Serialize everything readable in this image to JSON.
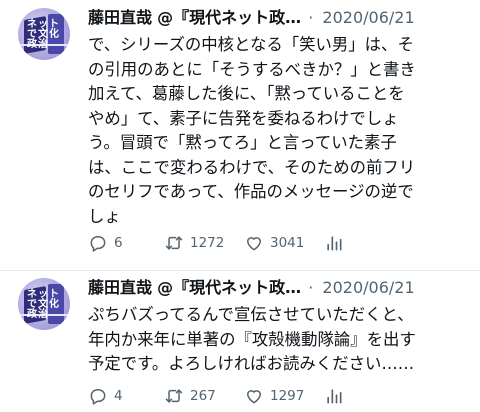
{
  "tweets": [
    {
      "author": "藤田直哉",
      "handle": "@『現代ネット政…",
      "separator": "·",
      "date": "2020/06/21",
      "lines": [
        "で、シリーズの中核となる「笑い男」は、そ",
        "の引用のあとに「そうするべきか？」と書き",
        "加えて、葛藤した後に、「黙っていることを",
        "やめ」て、素子に告発を委ねるわけでしょ",
        "う。冒頭で「黙ってろ」と言っていた素子",
        "は、ここで変わるわけで、そのための前フリ",
        "のセリフであって、作品のメッセージの逆で",
        "しょ"
      ],
      "replies": "6",
      "retweets": "1272",
      "likes": "3041"
    },
    {
      "author": "藤田直哉",
      "handle": "@『現代ネット政…",
      "separator": "·",
      "date": "2020/06/21",
      "lines": [
        "ぷちバズってるんで宣伝させていただくと、",
        "年内か来年に単著の『攻殻機動隊論』を出す",
        "予定です。よろしければお読みください……"
      ],
      "replies": "4",
      "retweets": "267",
      "likes": "1297"
    }
  ],
  "avatar_text": "ネットで文化政治",
  "colors": {
    "text": "#0f1419",
    "muted": "#536471",
    "divider": "#e6e9ec"
  },
  "icons": [
    "reply-icon",
    "retweet-icon",
    "like-icon",
    "views-icon"
  ]
}
